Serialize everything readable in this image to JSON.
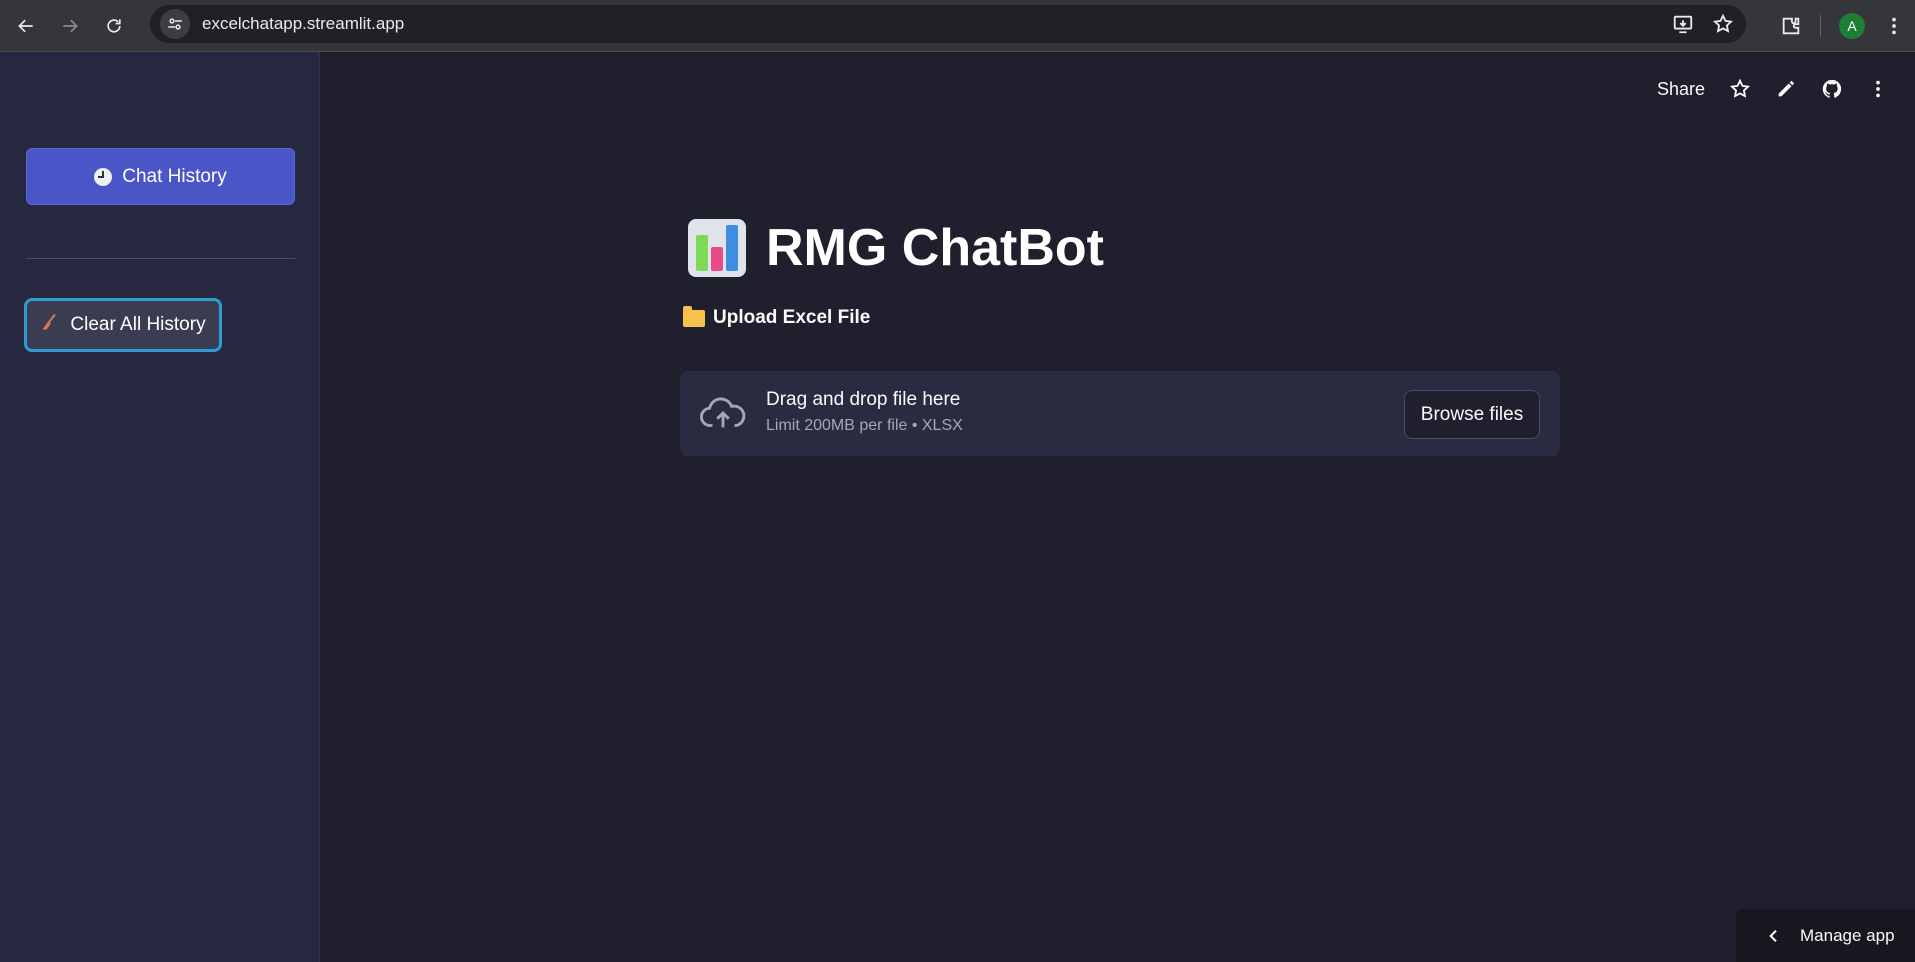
{
  "browser": {
    "url": "excelchatapp.streamlit.app",
    "profile_initial": "A"
  },
  "sidebar": {
    "chat_history_label": "Chat History",
    "clear_history_label": "Clear All History"
  },
  "toolbar": {
    "share_label": "Share"
  },
  "main": {
    "title": "RMG ChatBot",
    "upload_label": "Upload Excel File",
    "dropzone": {
      "title": "Drag and drop file here",
      "subtitle": "Limit 200MB per file • XLSX",
      "browse_label": "Browse files"
    }
  },
  "footer": {
    "manage_label": "Manage app"
  },
  "colors": {
    "background": "#1f1f2e",
    "sidebar": "#262840",
    "primary_button": "#4a56c8",
    "focus_ring": "#2d9bd6"
  }
}
